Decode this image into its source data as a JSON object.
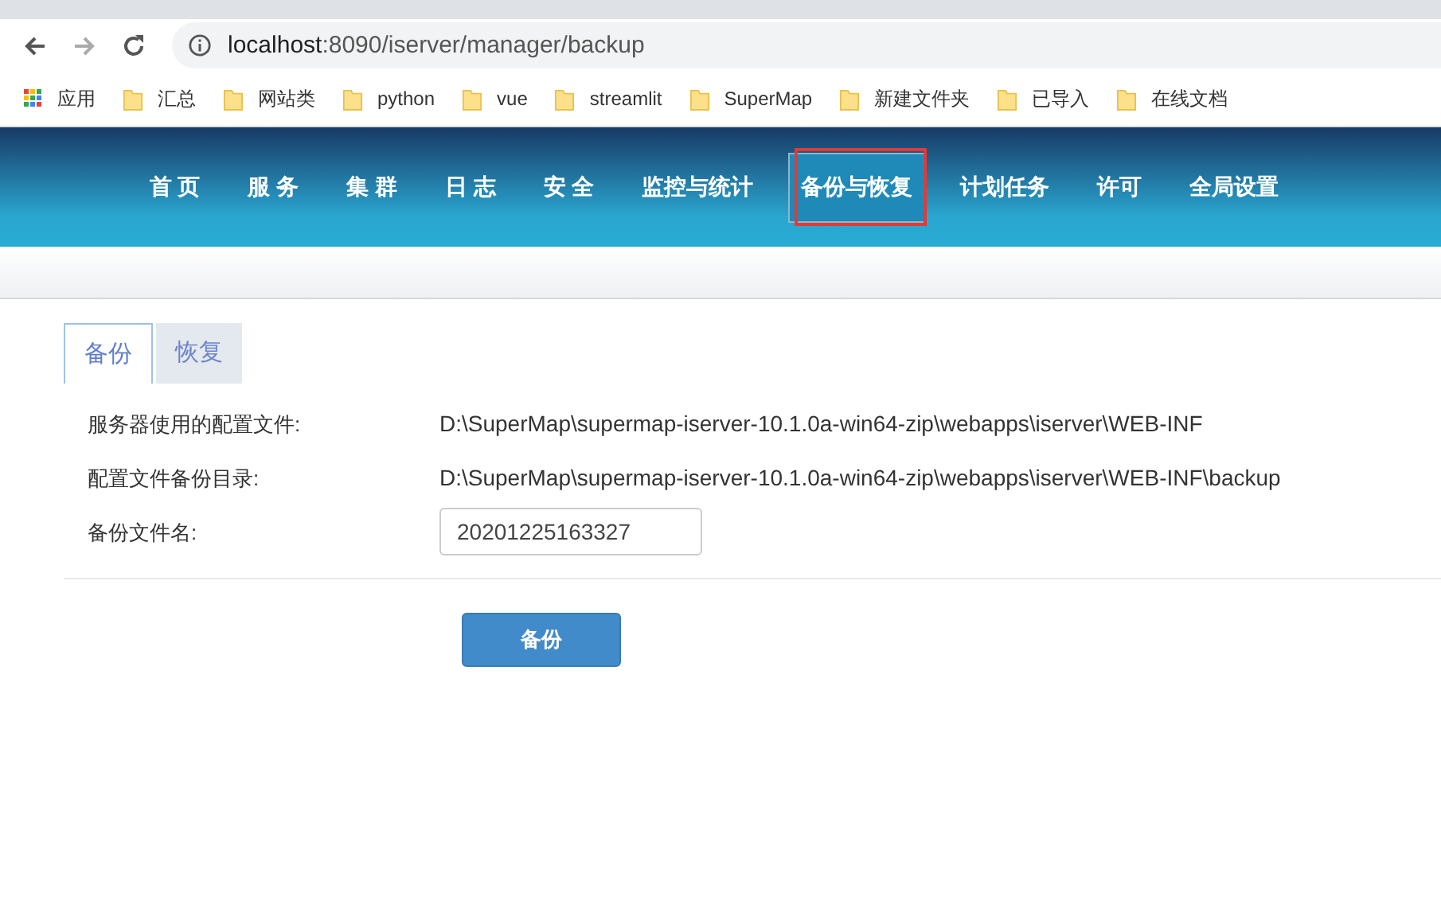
{
  "browser": {
    "url_host": "localhost",
    "url_rest": ":8090/iserver/manager/backup",
    "bookmarks": [
      {
        "label": "应用",
        "kind": "apps"
      },
      {
        "label": "汇总",
        "kind": "folder"
      },
      {
        "label": "网站类",
        "kind": "folder"
      },
      {
        "label": "python",
        "kind": "folder"
      },
      {
        "label": "vue",
        "kind": "folder"
      },
      {
        "label": "streamlit",
        "kind": "folder"
      },
      {
        "label": "SuperMap",
        "kind": "folder"
      },
      {
        "label": "新建文件夹",
        "kind": "folder"
      },
      {
        "label": "已导入",
        "kind": "folder"
      },
      {
        "label": "在线文档",
        "kind": "folder"
      }
    ]
  },
  "nav": [
    {
      "label": "首 页",
      "selected": false,
      "highlighted": false
    },
    {
      "label": "服 务",
      "selected": false,
      "highlighted": false
    },
    {
      "label": "集 群",
      "selected": false,
      "highlighted": false
    },
    {
      "label": "日 志",
      "selected": false,
      "highlighted": false
    },
    {
      "label": "安 全",
      "selected": false,
      "highlighted": false
    },
    {
      "label": "监控与统计",
      "selected": false,
      "highlighted": false
    },
    {
      "label": "备份与恢复",
      "selected": true,
      "highlighted": true
    },
    {
      "label": "计划任务",
      "selected": false,
      "highlighted": false
    },
    {
      "label": "许可",
      "selected": false,
      "highlighted": false
    },
    {
      "label": "全局设置",
      "selected": false,
      "highlighted": false
    }
  ],
  "tabs": [
    {
      "label": "备份",
      "selected": true
    },
    {
      "label": "恢复",
      "selected": false
    }
  ],
  "form": {
    "rows": [
      {
        "label": "服务器使用的配置文件:",
        "kind": "text",
        "value": "D:\\SuperMap\\supermap-iserver-10.1.0a-win64-zip\\webapps\\iserver\\WEB-INF"
      },
      {
        "label": "配置文件备份目录:",
        "kind": "text",
        "value": "D:\\SuperMap\\supermap-iserver-10.1.0a-win64-zip\\webapps\\iserver\\WEB-INF\\backup"
      },
      {
        "label": "备份文件名:",
        "kind": "input",
        "value": "20201225163327"
      }
    ],
    "button": "备份"
  }
}
